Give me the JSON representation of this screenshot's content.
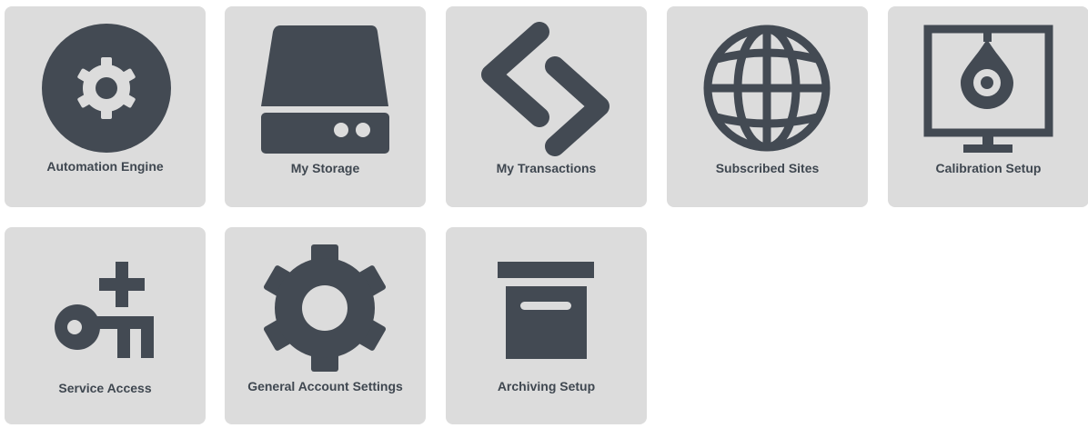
{
  "tiles": [
    {
      "label": "Automation Engine",
      "icon": "gear-circle-icon"
    },
    {
      "label": "My Storage",
      "icon": "hard-drive-icon"
    },
    {
      "label": "My Transactions",
      "icon": "code-arrows-icon"
    },
    {
      "label": "Subscribed Sites",
      "icon": "globe-icon"
    },
    {
      "label": "Calibration Setup",
      "icon": "monitor-drop-icon"
    },
    {
      "label": "Service Access",
      "icon": "key-plus-icon"
    },
    {
      "label": "General Account Settings",
      "icon": "gear-icon"
    },
    {
      "label": "Archiving Setup",
      "icon": "archive-box-icon"
    }
  ],
  "colors": {
    "tile_background": "#dcdcdc",
    "icon": "#434a53",
    "text": "#3f4750"
  }
}
